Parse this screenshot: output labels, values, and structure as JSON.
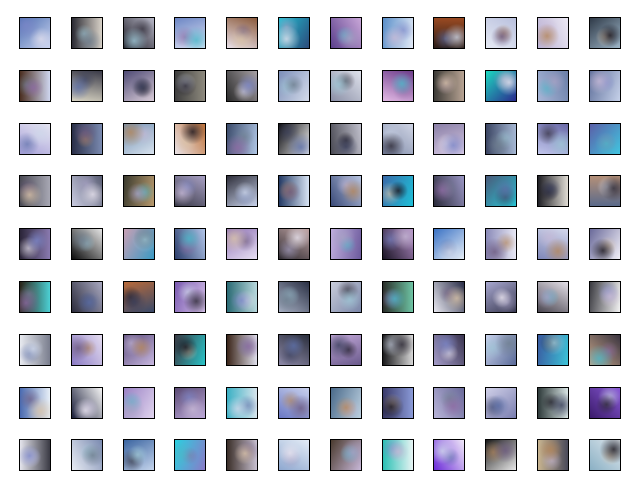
{
  "figure": {
    "rows": 9,
    "cols": 12,
    "frame_color": "#000000",
    "background": "#ffffff",
    "palette": [
      "#7b86c8",
      "#c7b9d6",
      "#3a3f5c",
      "#e9e4ef",
      "#8e6aa3",
      "#4bb7c9",
      "#b4865b",
      "#6f7f8f",
      "#cfd8ea",
      "#2e2a36",
      "#a7a1c4",
      "#5c6fa8",
      "#d9c3a8",
      "#18141d",
      "#9ec7d6",
      "#6d5a7f"
    ]
  },
  "tiles": [
    {
      "c1": "#4c6fb0",
      "c2": "#c9d3f0",
      "a": 135
    },
    {
      "c1": "#2a2a33",
      "c2": "#d9d2c8",
      "a": 90
    },
    {
      "c1": "#1d1b24",
      "c2": "#b8b8c8",
      "a": 45
    },
    {
      "c1": "#6c86c4",
      "c2": "#dfe4f5",
      "a": 160
    },
    {
      "c1": "#8b5a3c",
      "c2": "#e8e0e8",
      "a": 200
    },
    {
      "c1": "#1fc3d6",
      "c2": "#2c4a7a",
      "a": 120
    },
    {
      "c1": "#5b3f8c",
      "c2": "#c9a7d8",
      "a": 60
    },
    {
      "c1": "#5a8fc9",
      "c2": "#e3eaf6",
      "a": 100
    },
    {
      "c1": "#9a4a22",
      "c2": "#2b1d18",
      "a": 180
    },
    {
      "c1": "#e6eaf4",
      "c2": "#b9c0dd",
      "a": 30
    },
    {
      "c1": "#b9b0d3",
      "c2": "#ece9f4",
      "a": 70
    },
    {
      "c1": "#2f3a48",
      "c2": "#9fb7c9",
      "a": 140
    },
    {
      "c1": "#4a2d1f",
      "c2": "#cfd6ef",
      "a": 90
    },
    {
      "c1": "#d7d3c2",
      "c2": "#3a3a48",
      "a": 10
    },
    {
      "c1": "#4e4a74",
      "c2": "#d9ccd8",
      "a": 150
    },
    {
      "c1": "#3e3e3e",
      "c2": "#8e8a7e",
      "a": 90
    },
    {
      "c1": "#2b2b2b",
      "c2": "#a6a0a4",
      "a": 60
    },
    {
      "c1": "#7c8fb8",
      "c2": "#d4dbea",
      "a": 120
    },
    {
      "c1": "#8a8fa6",
      "c2": "#dfe2ec",
      "a": 45
    },
    {
      "c1": "#6d3d8b",
      "c2": "#e2b9e4",
      "a": 200
    },
    {
      "c1": "#3c3a36",
      "c2": "#b8a494",
      "a": 90
    },
    {
      "c1": "#1dd8c0",
      "c2": "#2a2a8e",
      "a": 135
    },
    {
      "c1": "#a8b6d7",
      "c2": "#6b7fa8",
      "a": 70
    },
    {
      "c1": "#5e6f9a",
      "c2": "#c7d2ea",
      "a": 110
    },
    {
      "c1": "#a6a0d8",
      "c2": "#e8e6f2",
      "a": 30
    },
    {
      "c1": "#2a2f48",
      "c2": "#7a8ab0",
      "a": 90
    },
    {
      "c1": "#6f8fb0",
      "c2": "#d8e2ee",
      "a": 150
    },
    {
      "c1": "#e8e2e6",
      "c2": "#c0733a",
      "a": 60
    },
    {
      "c1": "#3a4a6a",
      "c2": "#b0c6e4",
      "a": 100
    },
    {
      "c1": "#0c0c10",
      "c2": "#f0f0f0",
      "a": 120
    },
    {
      "c1": "#4a4a54",
      "c2": "#c0c0cc",
      "a": 80
    },
    {
      "c1": "#7e8aa8",
      "c2": "#cfd4e4",
      "a": 40
    },
    {
      "c1": "#8a7fa6",
      "c2": "#d6c9e4",
      "a": 160
    },
    {
      "c1": "#3a4462",
      "c2": "#a6b8d4",
      "a": 90
    },
    {
      "c1": "#c1c6ec",
      "c2": "#6a6aa8",
      "a": 20
    },
    {
      "c1": "#5a60a8",
      "c2": "#41c5e0",
      "a": 130
    },
    {
      "c1": "#4a4a54",
      "c2": "#a8a8b4",
      "a": 90
    },
    {
      "c1": "#c9cbe0",
      "c2": "#5a5e74",
      "a": 60
    },
    {
      "c1": "#3a3a2e",
      "c2": "#b89a6e",
      "a": 100
    },
    {
      "c1": "#3a3a48",
      "c2": "#a8a0c4",
      "a": 30
    },
    {
      "c1": "#2e2e3a",
      "c2": "#c8d2ea",
      "a": 150
    },
    {
      "c1": "#243a64",
      "c2": "#d8e4f4",
      "a": 90
    },
    {
      "c1": "#3a4a78",
      "c2": "#b8c4e0",
      "a": 60
    },
    {
      "c1": "#3a6aa8",
      "c2": "#1ec0d8",
      "a": 110
    },
    {
      "c1": "#2a2a3a",
      "c2": "#9a96c4",
      "a": 70
    },
    {
      "c1": "#4a5a7a",
      "c2": "#28c4d4",
      "a": 135
    },
    {
      "c1": "#1e1e24",
      "c2": "#e0dcd4",
      "a": 90
    },
    {
      "c1": "#b49078",
      "c2": "#5a6a8a",
      "a": 180
    },
    {
      "c1": "#2a2438",
      "c2": "#8a7ab0",
      "a": 90
    },
    {
      "c1": "#0c0c0c",
      "c2": "#e4e4e4",
      "a": 45
    },
    {
      "c1": "#c9a0b4",
      "c2": "#3a9ac4",
      "a": 120
    },
    {
      "c1": "#2c3e6c",
      "c2": "#b0c4e8",
      "a": 70
    },
    {
      "c1": "#8e72b4",
      "c2": "#e8e0f4",
      "a": 150
    },
    {
      "c1": "#2e2a30",
      "c2": "#c0a4a4",
      "a": 30
    },
    {
      "c1": "#c2b0e0",
      "c2": "#6c5a9c",
      "a": 100
    },
    {
      "c1": "#1a1424",
      "c2": "#b08ac4",
      "a": 60
    },
    {
      "c1": "#3a72c4",
      "c2": "#e4ecf6",
      "a": 140
    },
    {
      "c1": "#8a8ab8",
      "c2": "#e8e8f4",
      "a": 90
    },
    {
      "c1": "#7e86b8",
      "c2": "#d4d8ec",
      "a": 20
    },
    {
      "c1": "#6a6a9a",
      "c2": "#f2f0f8",
      "a": 120
    },
    {
      "c1": "#2a2418",
      "c2": "#4cd0d4",
      "a": 90
    },
    {
      "c1": "#2c2c3c",
      "c2": "#a8a8c0",
      "a": 60
    },
    {
      "c1": "#b86a3a",
      "c2": "#3a4a6a",
      "a": 160
    },
    {
      "c1": "#7a5ab0",
      "c2": "#d4c0e8",
      "a": 110
    },
    {
      "c1": "#2a6a74",
      "c2": "#b8d8dc",
      "a": 90
    },
    {
      "c1": "#a8b0c4",
      "c2": "#2a3044",
      "a": 40
    },
    {
      "c1": "#c8ccda",
      "c2": "#7a86a8",
      "a": 130
    },
    {
      "c1": "#2a2e2a",
      "c2": "#6ec4a4",
      "a": 90
    },
    {
      "c1": "#e8e8f0",
      "c2": "#2a2e48",
      "a": 60
    },
    {
      "c1": "#a8a8d0",
      "c2": "#3a3a52",
      "a": 150
    },
    {
      "c1": "#4a4650",
      "c2": "#e4e0e8",
      "a": 30
    },
    {
      "c1": "#3a3a40",
      "c2": "#f4f4f4",
      "a": 100
    },
    {
      "c1": "#e8eaf0",
      "c2": "#7a7e8e",
      "a": 90
    },
    {
      "c1": "#8a7ac4",
      "c2": "#e4dcf0",
      "a": 60
    },
    {
      "c1": "#5a4a7a",
      "c2": "#c8b8e0",
      "a": 140
    },
    {
      "c1": "#3a3a44",
      "c2": "#2ac4c8",
      "a": 110
    },
    {
      "c1": "#3a2418",
      "c2": "#e0e0ec",
      "a": 90
    },
    {
      "c1": "#8e8aa8",
      "c2": "#2a2e3c",
      "a": 30
    },
    {
      "c1": "#c2a8d8",
      "c2": "#6a5a8c",
      "a": 160
    },
    {
      "c1": "#1a1a1c",
      "c2": "#d8d8d8",
      "a": 90
    },
    {
      "c1": "#a49cc8",
      "c2": "#3a3450",
      "a": 60
    },
    {
      "c1": "#c8d2ec",
      "c2": "#5a6a98",
      "a": 120
    },
    {
      "c1": "#3a5aa0",
      "c2": "#3cc4d8",
      "a": 100
    },
    {
      "c1": "#c4a488",
      "c2": "#3a3440",
      "a": 45
    },
    {
      "c1": "#4a6ab0",
      "c2": "#e8f0f8",
      "a": 90
    },
    {
      "c1": "#1a1e3a",
      "c2": "#f4f4f4",
      "a": 60
    },
    {
      "c1": "#9a82c4",
      "c2": "#e0d4ee",
      "a": 120
    },
    {
      "c1": "#5a4a74",
      "c2": "#bca8d8",
      "a": 150
    },
    {
      "c1": "#3ab0c4",
      "c2": "#d8e4ec",
      "a": 90
    },
    {
      "c1": "#6a78c4",
      "c2": "#c8d0ec",
      "a": 30
    },
    {
      "c1": "#4a6a8a",
      "c2": "#bcd0e0",
      "a": 110
    },
    {
      "c1": "#3a3a6a",
      "c2": "#8a9ad8",
      "a": 90
    },
    {
      "c1": "#b8b4d8",
      "c2": "#6a6a9a",
      "a": 60
    },
    {
      "c1": "#d0d0e8",
      "c2": "#7a7eb0",
      "a": 140
    },
    {
      "c1": "#2e3a3a",
      "c2": "#d8e4e4",
      "a": 90
    },
    {
      "c1": "#3a1a6a",
      "c2": "#8a5ad8",
      "a": 45
    },
    {
      "c1": "#e4e4ec",
      "c2": "#3a3a44",
      "a": 90
    },
    {
      "c1": "#e8ecf4",
      "c2": "#7a8ab0",
      "a": 60
    },
    {
      "c1": "#3a64a0",
      "c2": "#c4d4ec",
      "a": 150
    },
    {
      "c1": "#2ad0e0",
      "c2": "#8a7ac8",
      "a": 110
    },
    {
      "c1": "#3a2e28",
      "c2": "#c8c0d0",
      "a": 90
    },
    {
      "c1": "#8ea8d0",
      "c2": "#e4ecf6",
      "a": 30
    },
    {
      "c1": "#4a3a2e",
      "c2": "#c8b8d8",
      "a": 120
    },
    {
      "c1": "#2ac0b4",
      "c2": "#e8f4f4",
      "a": 90
    },
    {
      "c1": "#6a2ad8",
      "c2": "#f0e8f8",
      "a": 60
    },
    {
      "c1": "#1a1a1a",
      "c2": "#e8e8e8",
      "a": 140
    },
    {
      "c1": "#c8b490",
      "c2": "#4a4a5a",
      "a": 90
    },
    {
      "c1": "#8ab0c4",
      "c2": "#e0e8ee",
      "a": 45
    }
  ]
}
